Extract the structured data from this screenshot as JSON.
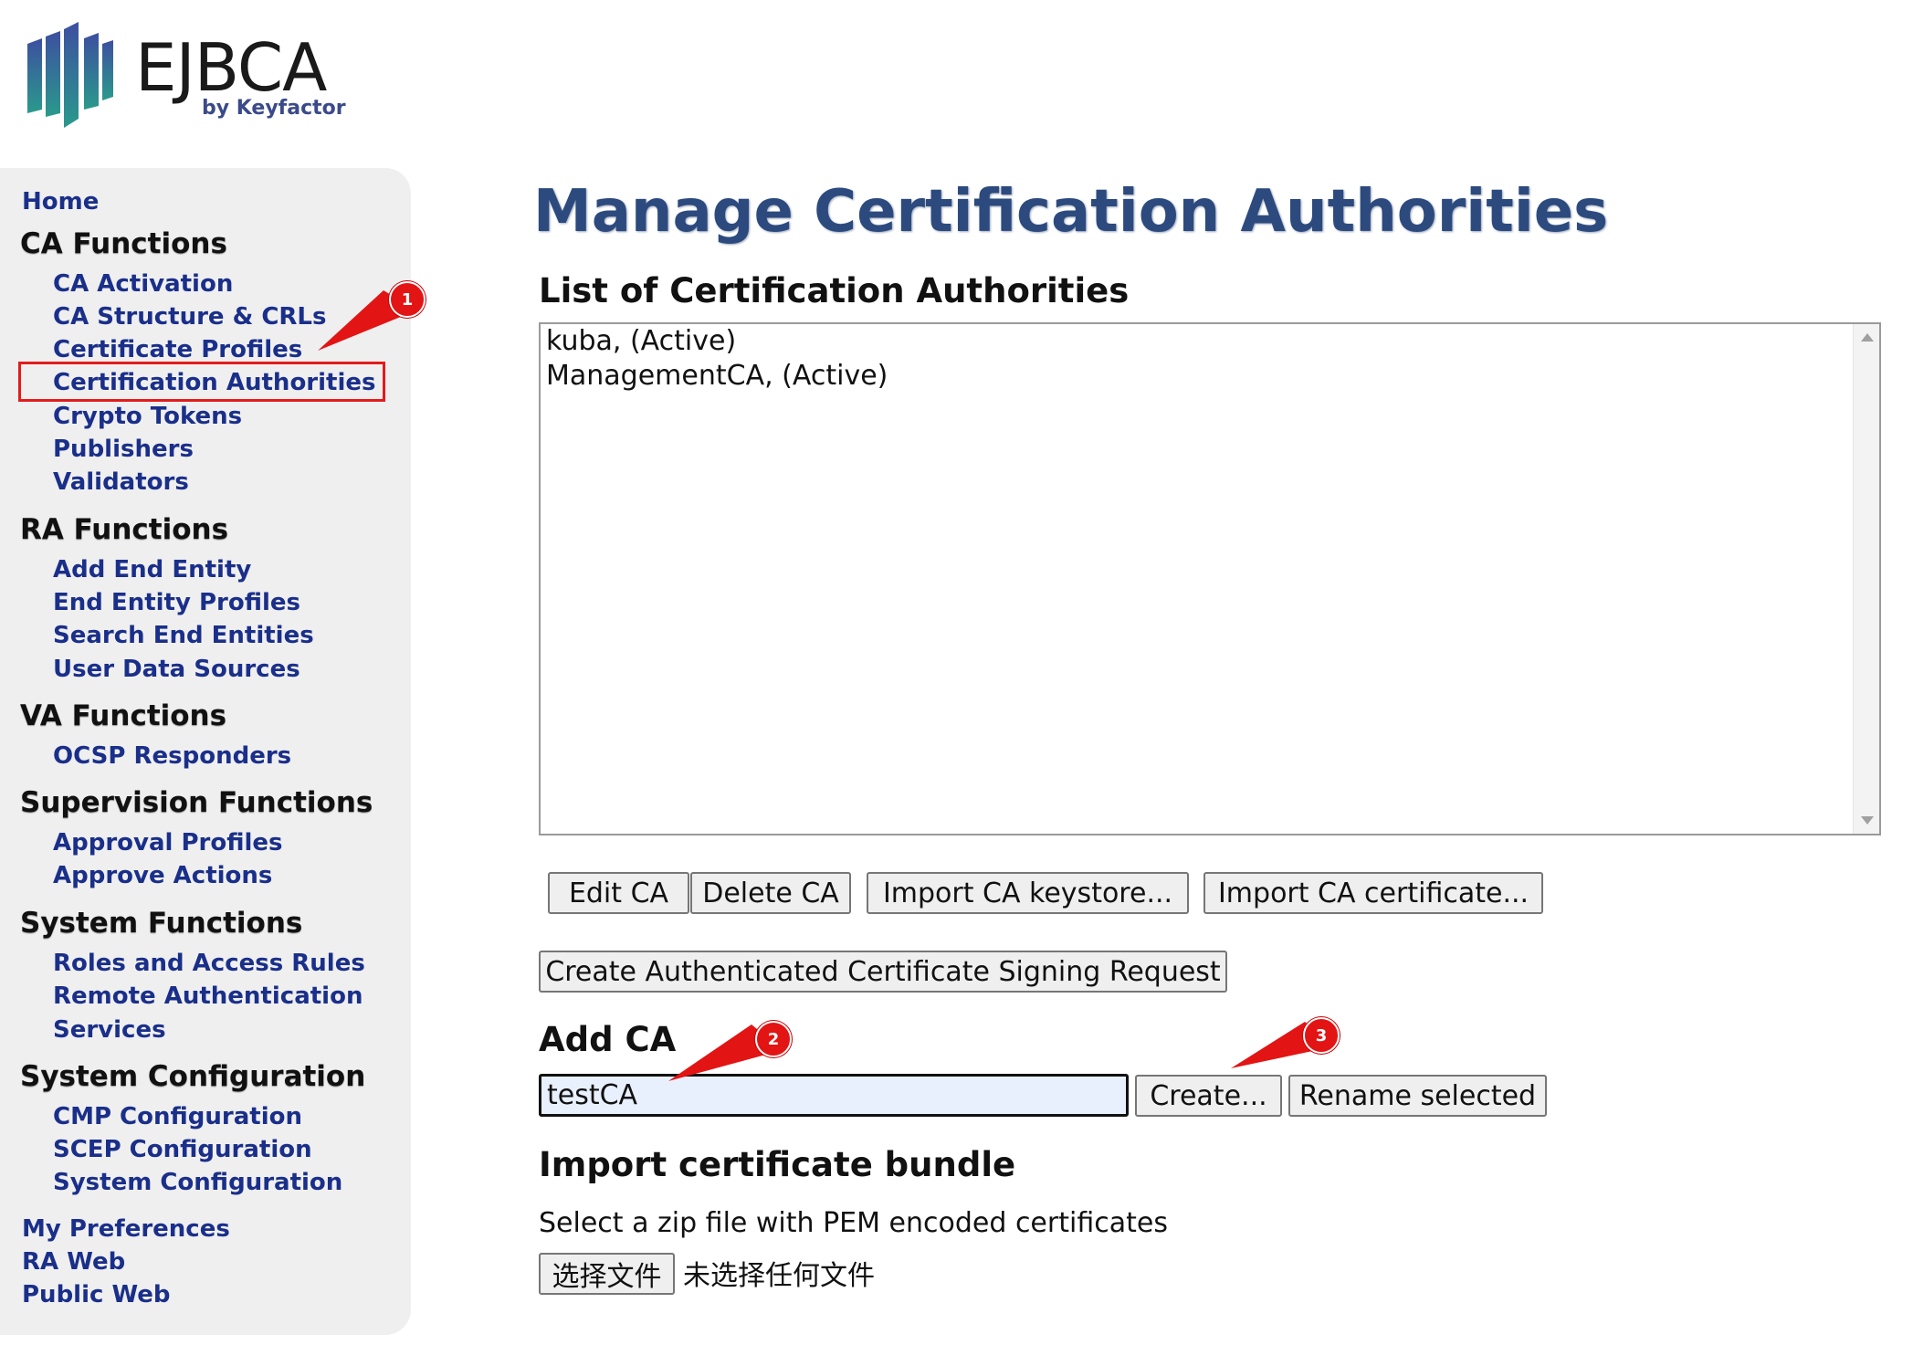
{
  "logo": {
    "name": "EJBCA",
    "sub": "by Keyfactor"
  },
  "sidebar": {
    "home": "Home",
    "sections": [
      {
        "title": "CA Functions",
        "items": [
          "CA Activation",
          "CA Structure & CRLs",
          "Certificate Profiles",
          "Certification Authorities",
          "Crypto Tokens",
          "Publishers",
          "Validators"
        ]
      },
      {
        "title": "RA Functions",
        "items": [
          "Add End Entity",
          "End Entity Profiles",
          "Search End Entities",
          "User Data Sources"
        ]
      },
      {
        "title": "VA Functions",
        "items": [
          "OCSP Responders"
        ]
      },
      {
        "title": "Supervision Functions",
        "items": [
          "Approval Profiles",
          "Approve Actions"
        ]
      },
      {
        "title": "System Functions",
        "items": [
          "Roles and Access Rules",
          "Remote Authentication",
          "Services"
        ]
      },
      {
        "title": "System Configuration",
        "items": [
          "CMP Configuration",
          "SCEP Configuration",
          "System Configuration"
        ]
      }
    ],
    "footer": [
      "My Preferences",
      "RA Web",
      "Public Web"
    ],
    "selected": "Certification Authorities"
  },
  "main": {
    "title": "Manage Certification Authorities",
    "list_heading": "List of Certification Authorities",
    "ca_list": [
      "kuba, (Active)",
      "ManagementCA, (Active)"
    ],
    "buttons": {
      "edit": "Edit CA",
      "delete": "Delete CA",
      "import_keystore": "Import CA keystore...",
      "import_cert": "Import CA certificate...",
      "create_csr": "Create Authenticated Certificate Signing Request"
    },
    "add_ca": {
      "heading": "Add CA",
      "value": "testCA",
      "create": "Create...",
      "rename": "Rename selected"
    },
    "import_bundle": {
      "heading": "Import certificate bundle",
      "description": "Select a zip file with PEM encoded certificates",
      "choose_file": "选择文件",
      "no_file": "未选择任何文件"
    }
  },
  "annotations": [
    "1",
    "2",
    "3"
  ],
  "colors": {
    "nav_link": "#1a2f8a",
    "title": "#2c4a7e",
    "annotation": "#e31414",
    "sidebar_bg": "#efefef"
  }
}
